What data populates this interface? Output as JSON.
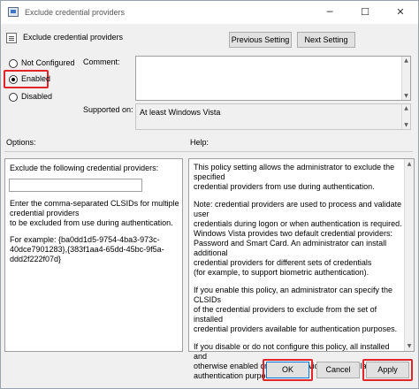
{
  "window": {
    "title": "Exclude credential providers",
    "icon": "policy-icon",
    "minimize_glyph": "─",
    "maximize_glyph": "☐",
    "close_glyph": "✕"
  },
  "header": {
    "title": "Exclude credential providers",
    "prev_label": "Previous Setting",
    "next_label": "Next Setting"
  },
  "state": {
    "options": [
      "Not Configured",
      "Enabled",
      "Disabled"
    ],
    "selected": "Enabled"
  },
  "comment": {
    "label": "Comment:",
    "value": ""
  },
  "supported": {
    "label": "Supported on:",
    "value": "At least Windows Vista"
  },
  "options_pane": {
    "heading": "Options:",
    "field_label": "Exclude the following credential providers:",
    "field_value": "",
    "instructions": [
      "Enter the comma-separated CLSIDs for multiple",
      "credential   providers",
      "to be excluded from use during authentication."
    ],
    "example": [
      "For example: {ba0dd1d5-9754-4ba3-973c-",
      "40dce7901283},{383f1aa4-65dd-45bc-9f5a-",
      "ddd2f222f07d}"
    ]
  },
  "help_pane": {
    "heading": "Help:",
    "paragraphs": [
      [
        "This policy setting allows the administrator to exclude the",
        "specified",
        "credential providers from use during authentication."
      ],
      [
        "Note: credential providers are used to process and validate user",
        "credentials during logon or when authentication is required.",
        "Windows Vista provides two default credential providers:",
        "Password and Smart Card. An administrator can install additional",
        "credential providers for different sets of credentials",
        "(for example, to support biometric authentication)."
      ],
      [
        "If you enable this policy, an administrator can specify the CLSIDs",
        "of the credential providers to exclude from the set of installed",
        "credential providers available for authentication purposes."
      ],
      [
        "If you disable or do not configure this policy, all installed and",
        "otherwise enabled credential providers are available for",
        "authentication purposes."
      ]
    ]
  },
  "footer": {
    "ok_label": "OK",
    "cancel_label": "Cancel",
    "apply_label": "Apply"
  },
  "colors": {
    "highlight": "#e0252b",
    "dialog_bg": "#f0f0f0"
  }
}
